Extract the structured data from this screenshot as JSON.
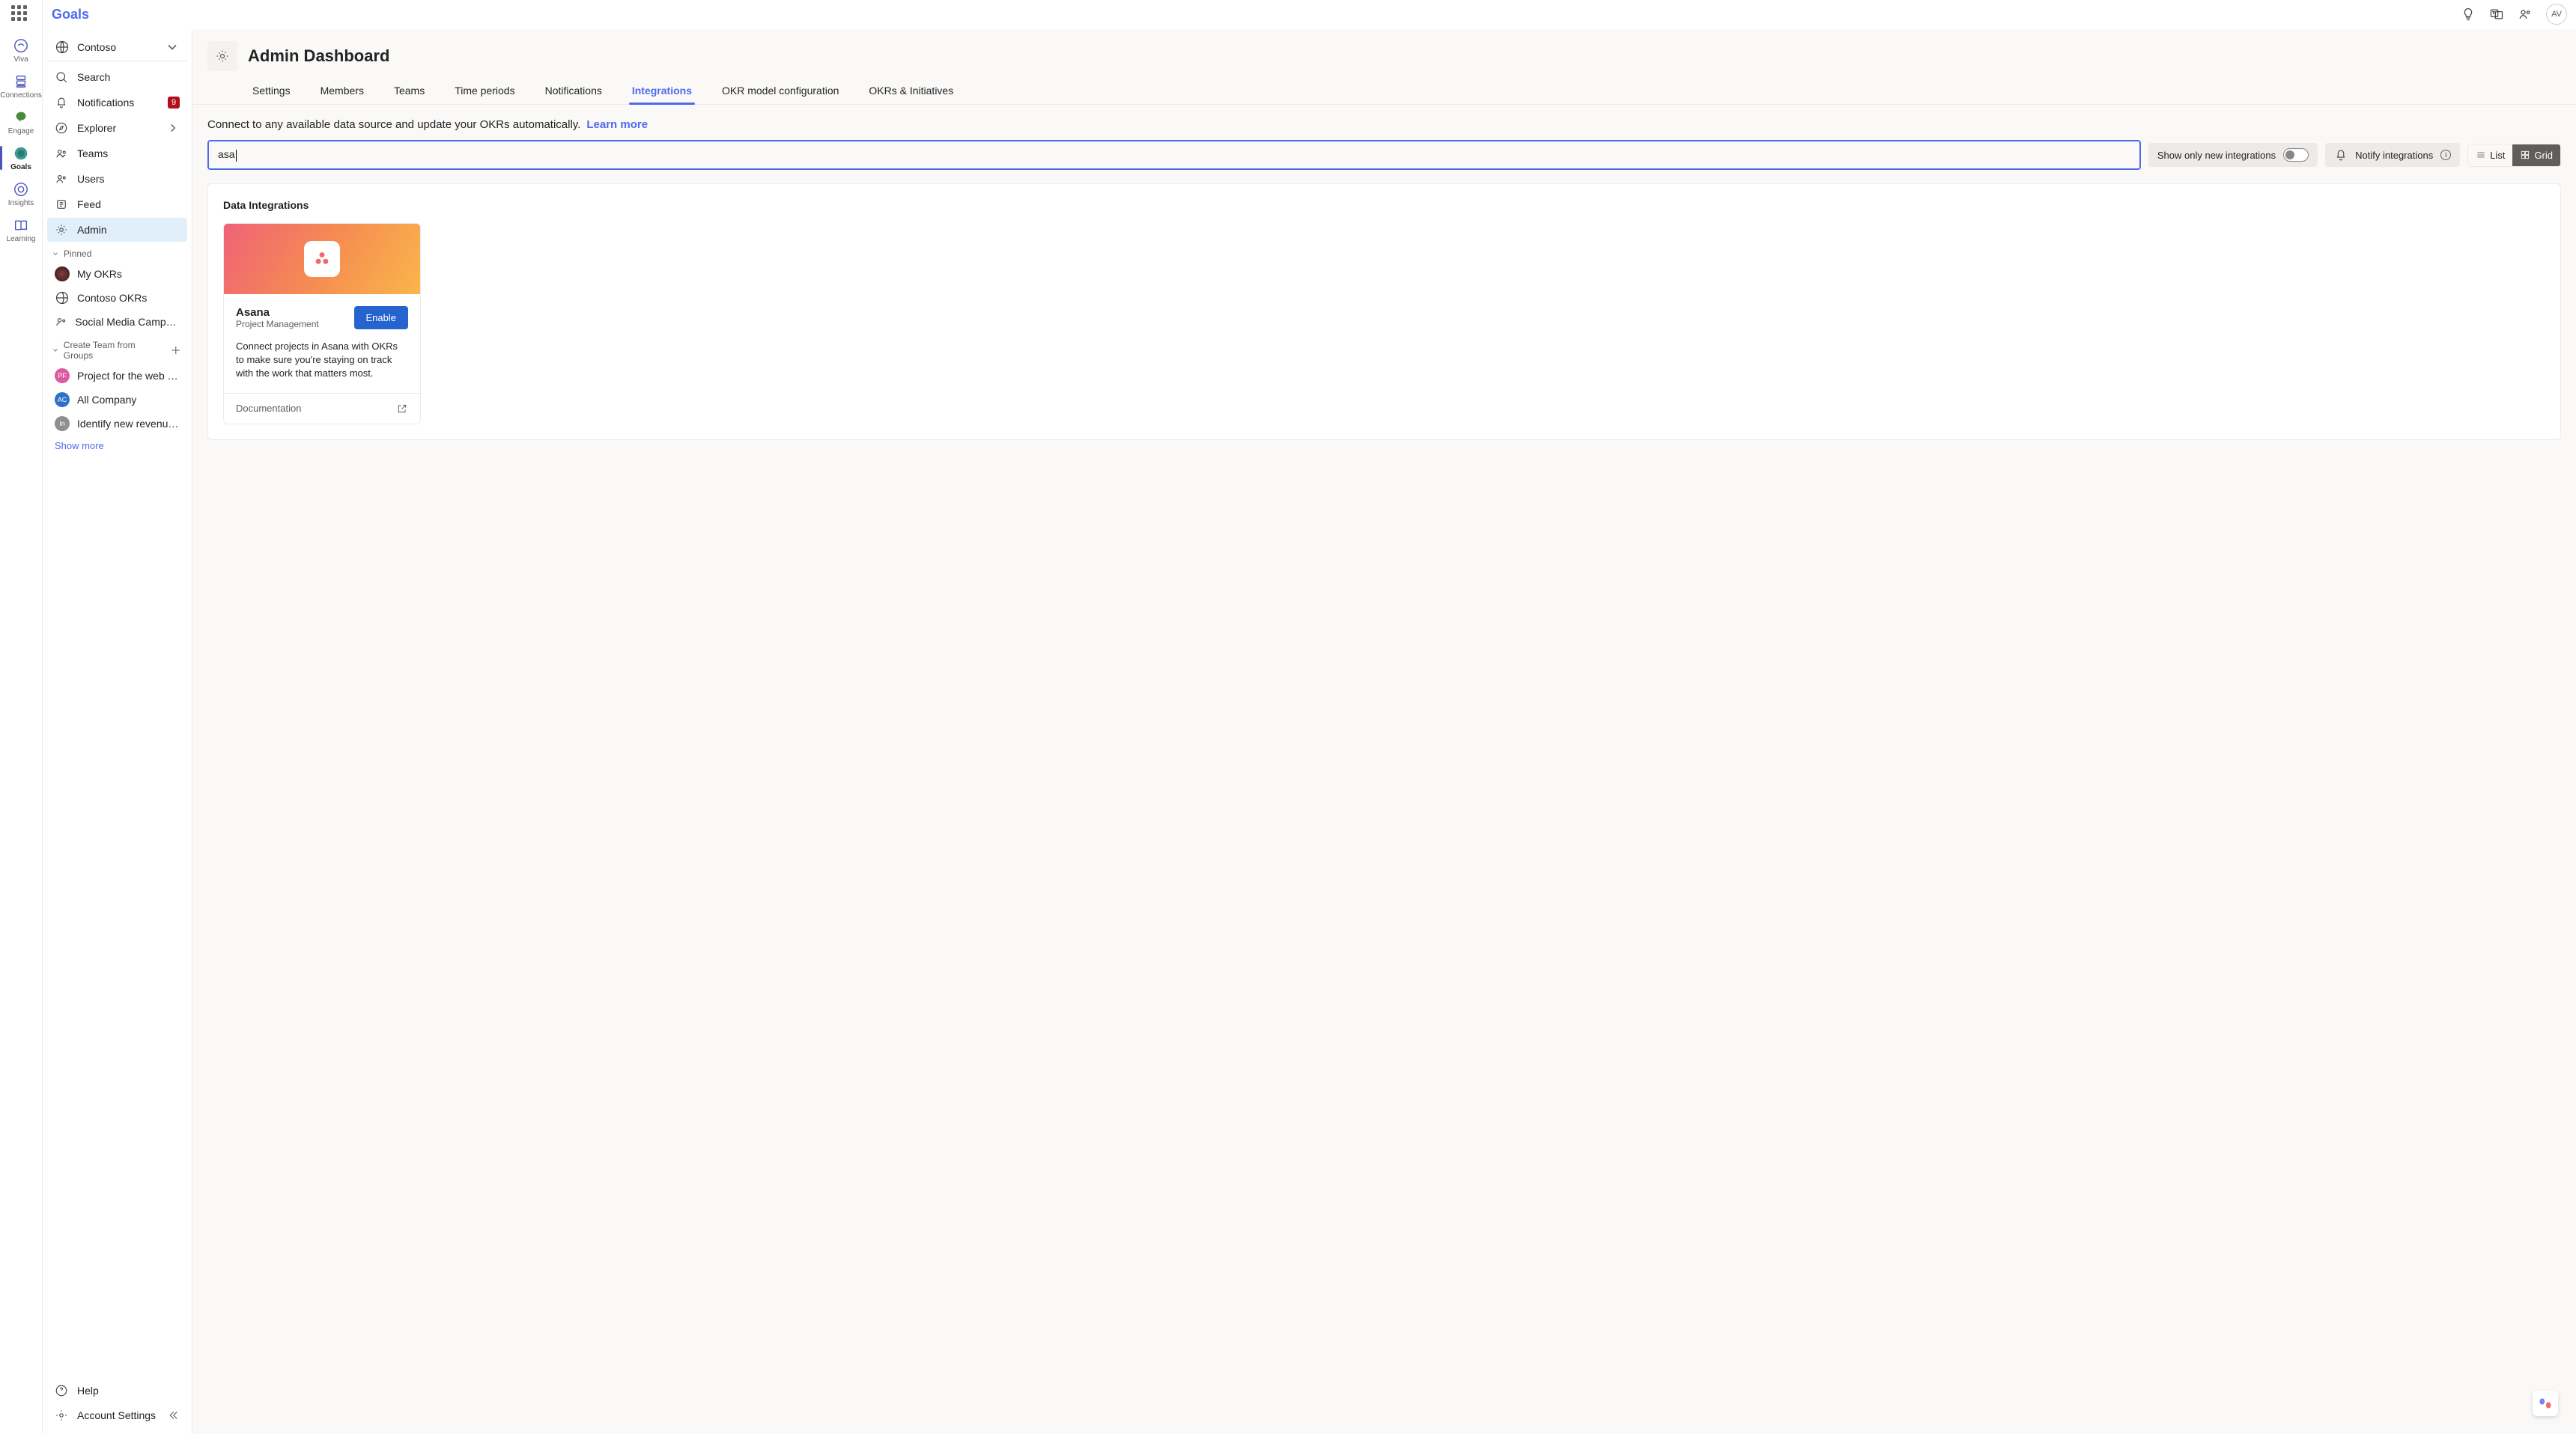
{
  "brand": "Goals",
  "avatar": "AV",
  "rail": [
    {
      "label": "Viva"
    },
    {
      "label": "Connections"
    },
    {
      "label": "Engage"
    },
    {
      "label": "Goals"
    },
    {
      "label": "Insights"
    },
    {
      "label": "Learning"
    }
  ],
  "org": "Contoso",
  "nav": [
    {
      "label": "Search"
    },
    {
      "label": "Notifications",
      "badge": "9"
    },
    {
      "label": "Explorer"
    },
    {
      "label": "Teams"
    },
    {
      "label": "Users"
    },
    {
      "label": "Feed"
    },
    {
      "label": "Admin"
    }
  ],
  "pinned_label": "Pinned",
  "pinned": [
    {
      "label": "My OKRs",
      "color": "#6b2e2e",
      "init": ""
    },
    {
      "label": "Contoso OKRs",
      "icon": "globe"
    },
    {
      "label": "Social Media Campaign…",
      "icon": "okr"
    }
  ],
  "groups_label": "Create Team from Groups",
  "groups": [
    {
      "label": "Project for the web (i…",
      "init": "PF",
      "color": "#de5ba0"
    },
    {
      "label": "All Company",
      "init": "AC",
      "color": "#2c72c8"
    },
    {
      "label": "Identify new revenue …",
      "init": "In",
      "color": "#8f8f8f"
    }
  ],
  "show_more": "Show more",
  "help": "Help",
  "account_settings": "Account Settings",
  "page_title": "Admin Dashboard",
  "tabs": [
    "Settings",
    "Members",
    "Teams",
    "Time periods",
    "Notifications",
    "Integrations",
    "OKR model configuration",
    "OKRs & Initiatives"
  ],
  "intro": "Connect to any available data source and update your OKRs automatically.",
  "learn_more": "Learn more",
  "search_value": "asa",
  "show_only": "Show only new integrations",
  "notify": "Notify integrations",
  "view_list": "List",
  "view_grid": "Grid",
  "panel_title": "Data Integrations",
  "card": {
    "name": "Asana",
    "sub": "Project Management",
    "enable": "Enable",
    "desc": "Connect projects in Asana with OKRs to make sure you're staying on track with the work that matters most.",
    "doc": "Documentation"
  }
}
